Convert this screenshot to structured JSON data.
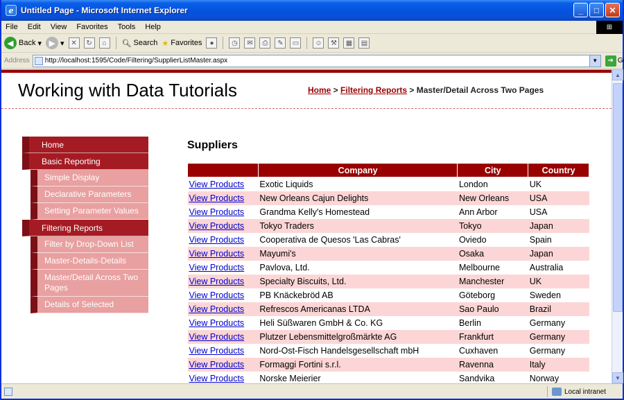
{
  "window": {
    "title": "Untitled Page - Microsoft Internet Explorer"
  },
  "menubar": [
    "File",
    "Edit",
    "View",
    "Favorites",
    "Tools",
    "Help"
  ],
  "toolbar": {
    "back_label": "Back",
    "search_label": "Search",
    "favorites_label": "Favorites"
  },
  "address": {
    "label": "Address",
    "url": "http://localhost:1595/Code/Filtering/SupplierListMaster.aspx",
    "go_label": "Go"
  },
  "page": {
    "site_title": "Working with Data Tutorials",
    "breadcrumb": {
      "home": "Home",
      "sep1": " > ",
      "filtering": "Filtering Reports",
      "sep2": " > ",
      "current": "Master/Detail Across Two Pages"
    },
    "heading": "Suppliers"
  },
  "sidebar": [
    {
      "label": "Home",
      "level": 0
    },
    {
      "label": "Basic Reporting",
      "level": 0
    },
    {
      "label": "Simple Display",
      "level": 1
    },
    {
      "label": "Declarative Parameters",
      "level": 1
    },
    {
      "label": "Setting Parameter Values",
      "level": 1
    },
    {
      "label": "Filtering Reports",
      "level": 0
    },
    {
      "label": "Filter by Drop-Down List",
      "level": 1
    },
    {
      "label": "Master-Details-Details",
      "level": 1
    },
    {
      "label": "Master/Detail Across Two Pages",
      "level": 1
    },
    {
      "label": "Details of Selected",
      "level": 1
    }
  ],
  "grid": {
    "headers": [
      "",
      "Company",
      "City",
      "Country"
    ],
    "link_text": "View Products",
    "rows": [
      [
        "Exotic Liquids",
        "London",
        "UK"
      ],
      [
        "New Orleans Cajun Delights",
        "New Orleans",
        "USA"
      ],
      [
        "Grandma Kelly's Homestead",
        "Ann Arbor",
        "USA"
      ],
      [
        "Tokyo Traders",
        "Tokyo",
        "Japan"
      ],
      [
        "Cooperativa de Quesos 'Las Cabras'",
        "Oviedo",
        "Spain"
      ],
      [
        "Mayumi's",
        "Osaka",
        "Japan"
      ],
      [
        "Pavlova, Ltd.",
        "Melbourne",
        "Australia"
      ],
      [
        "Specialty Biscuits, Ltd.",
        "Manchester",
        "UK"
      ],
      [
        "PB Knäckebröd AB",
        "Göteborg",
        "Sweden"
      ],
      [
        "Refrescos Americanas LTDA",
        "Sao Paulo",
        "Brazil"
      ],
      [
        "Heli Süßwaren GmbH & Co. KG",
        "Berlin",
        "Germany"
      ],
      [
        "Plutzer Lebensmittelgroßmärkte AG",
        "Frankfurt",
        "Germany"
      ],
      [
        "Nord-Ost-Fisch Handelsgesellschaft mbH",
        "Cuxhaven",
        "Germany"
      ],
      [
        "Formaggi Fortini s.r.l.",
        "Ravenna",
        "Italy"
      ],
      [
        "Norske Meierier",
        "Sandvika",
        "Norway"
      ]
    ]
  },
  "status": {
    "zone": "Local intranet"
  },
  "colors": {
    "accent": "#990000",
    "alt_row": "#fcd6d6",
    "menu": "#a51b24",
    "submenu": "#e8a0a0"
  }
}
